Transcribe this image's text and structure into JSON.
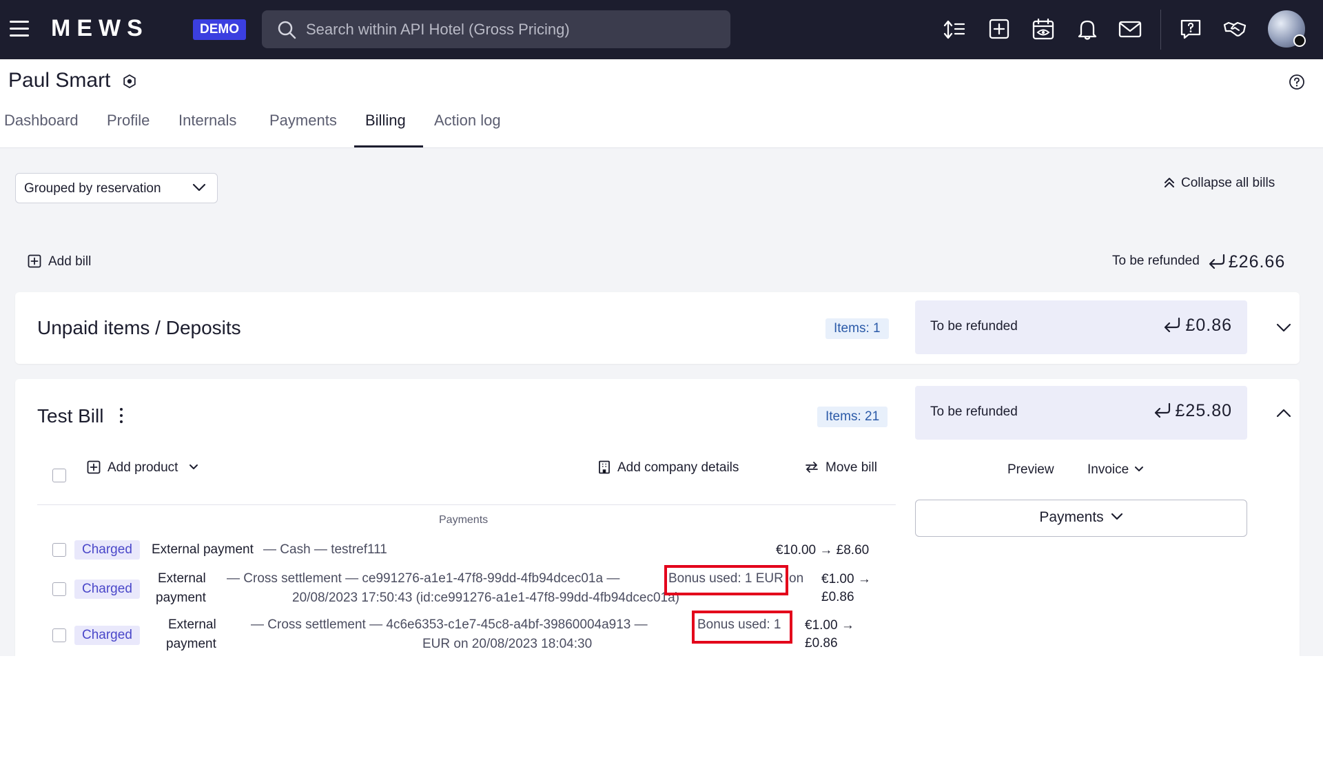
{
  "topbar": {
    "logo": "MEWS",
    "demo_badge": "DEMO",
    "search_placeholder": "Search within API Hotel (Gross Pricing)",
    "icons": [
      "sort-icon",
      "add-square-icon",
      "calendar-eye-icon",
      "bell-icon",
      "mail-icon",
      "help-chat-icon",
      "handshake-icon"
    ]
  },
  "customer": {
    "name": "Paul Smart"
  },
  "tabs": [
    {
      "label": "Dashboard",
      "active": false
    },
    {
      "label": "Profile",
      "active": false
    },
    {
      "label": "Internals",
      "active": false
    },
    {
      "label": "Payments",
      "active": false
    },
    {
      "label": "Billing",
      "active": true
    },
    {
      "label": "Action log",
      "active": false
    }
  ],
  "billing": {
    "group_by": "Grouped by reservation",
    "collapse_all": "Collapse all bills",
    "add_bill": "Add bill",
    "total_refund_label": "To be refunded",
    "total_refund_amount": "£26.66"
  },
  "bills": [
    {
      "title": "Unpaid items / Deposits",
      "items": "Items: 1",
      "refund_label": "To be refunded",
      "refund_amount": "£0.86",
      "expanded": false
    },
    {
      "title": "Test Bill",
      "items": "Items: 21",
      "refund_label": "To be refunded",
      "refund_amount": "£25.80",
      "expanded": true,
      "toolbar": {
        "add_product": "Add product",
        "add_company": "Add company details",
        "move_bill": "Move bill",
        "preview": "Preview",
        "invoice": "Invoice",
        "payments_button": "Payments"
      },
      "section_label": "Payments",
      "rows": [
        {
          "status": "Charged",
          "type": "External payment",
          "desc": "— Cash — testref111",
          "amount": "€10.00 → £8.60"
        },
        {
          "status": "Charged",
          "type_line1": "External",
          "type_line2": "payment",
          "desc_a": "— Cross settlement — ce991276-a1e1-47f8-99dd-4fb94dcec01a —",
          "desc_bonus": "Bonus used: 1 EUR",
          "desc_on": "on",
          "desc_line2": "20/08/2023 17:50:43 (id:ce991276-a1e1-47f8-99dd-4fb94dcec01a)",
          "amount_line1": "€1.00 →",
          "amount_line2": "£0.86"
        },
        {
          "status": "Charged",
          "type_line1": "External",
          "type_line2": "payment",
          "desc_a": "— Cross settlement — 4c6e6353-c1e7-45c8-a4bf-39860004a913 —",
          "desc_bonus": "Bonus used: 1",
          "desc_line2": "EUR on 20/08/2023 18:04:30",
          "amount_line1": "€1.00 →",
          "amount_line2": "£0.86"
        }
      ]
    }
  ],
  "colors": {
    "topbar": "#1c1d2e",
    "demo_badge": "#3b3fe0",
    "status_badge": "#e9e8fb",
    "highlight": "#e3001b"
  }
}
